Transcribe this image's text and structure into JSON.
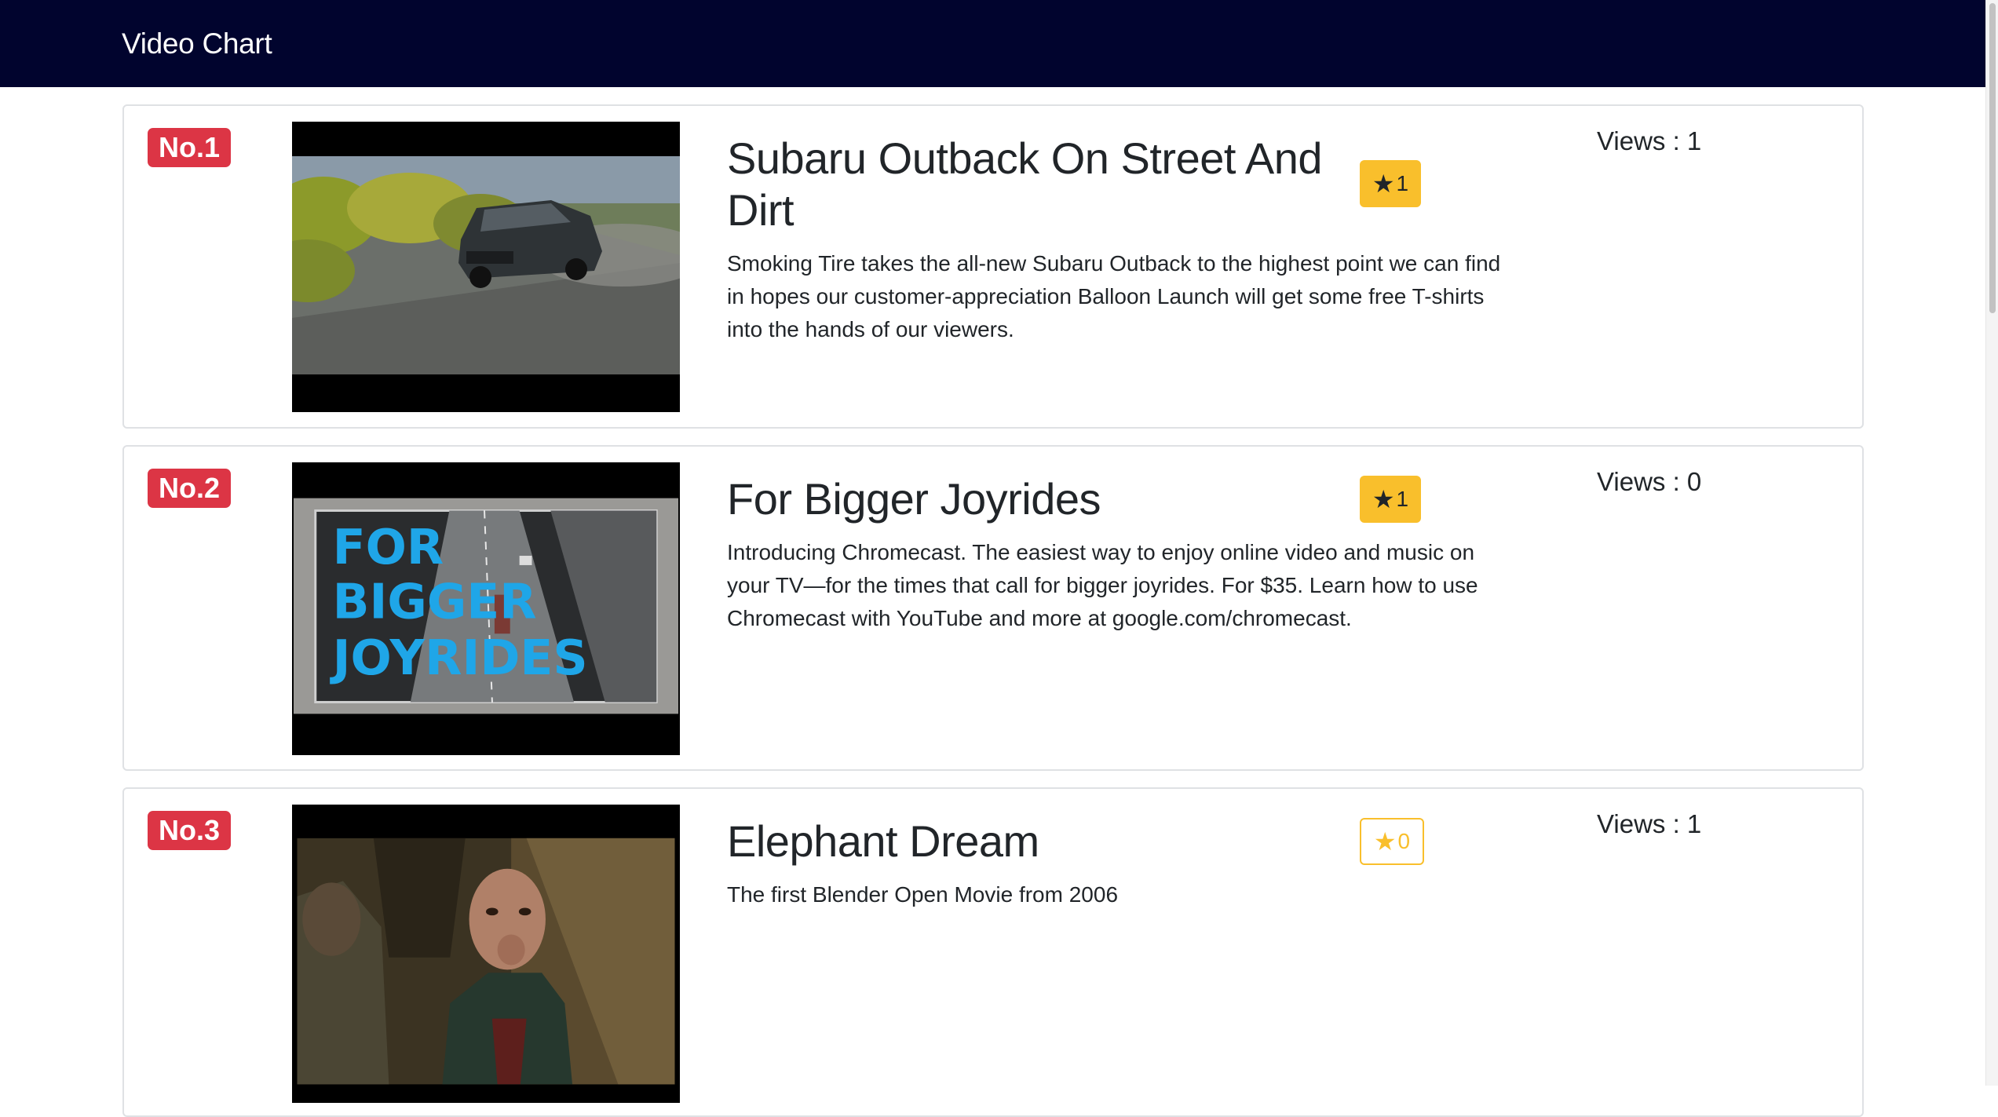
{
  "navbar": {
    "brand": "Video Chart"
  },
  "videos": [
    {
      "rank": "No.1",
      "title": "Subaru Outback On Street And Dirt",
      "description": "Smoking Tire takes the all-new Subaru Outback to the highest point we can find in hopes our customer-appreciation Balloon Launch will get some free T-shirts into the hands of our viewers.",
      "favorite_count": "1",
      "favorited": true,
      "views": "Views : 1",
      "thumbnail_icon": "car-video-thumbnail"
    },
    {
      "rank": "No.2",
      "title": "For Bigger Joyrides",
      "description": "Introducing Chromecast. The easiest way to enjoy online video and music on your TV—for the times that call for bigger joyrides. For $35. Learn how to use Chromecast with YouTube and more at google.com/chromecast.",
      "favorite_count": "1",
      "favorited": true,
      "views": "Views : 0",
      "thumbnail_text": [
        "FOR",
        "BIGGER",
        "JOYRIDES"
      ],
      "thumbnail_icon": "joyrides-video-thumbnail"
    },
    {
      "rank": "No.3",
      "title": "Elephant Dream",
      "description": "The first Blender Open Movie from 2006",
      "favorite_count": "0",
      "favorited": false,
      "views": "Views : 1",
      "thumbnail_icon": "elephant-dream-video-thumbnail"
    }
  ],
  "colors": {
    "navbar_bg": "#01042e",
    "rank_badge": "#dc3545",
    "favorite": "#f9bf2c",
    "card_border": "#dfe1e4"
  }
}
